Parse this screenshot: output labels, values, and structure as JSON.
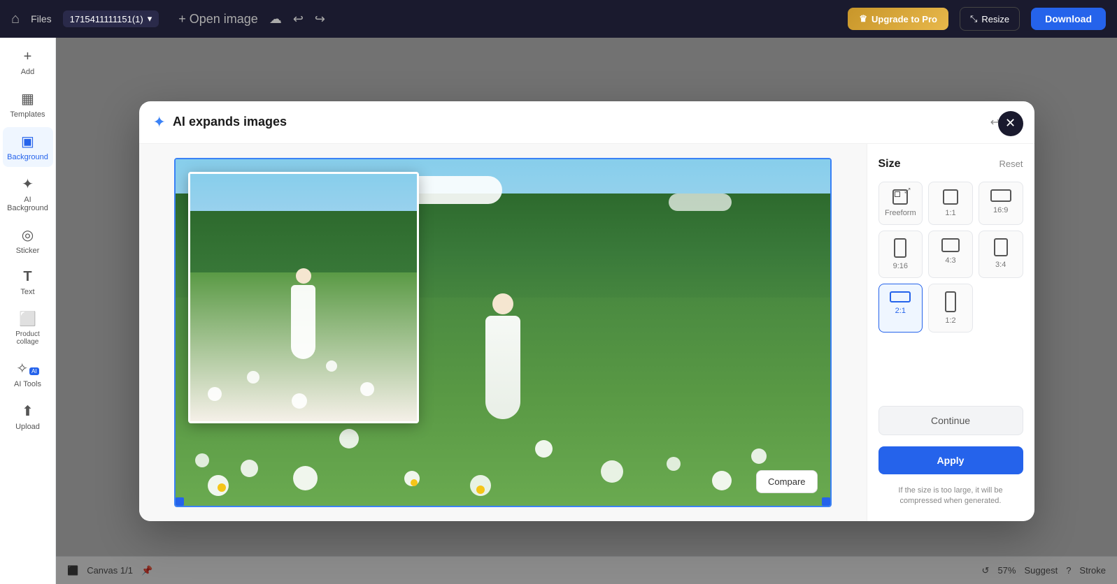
{
  "topbar": {
    "home_icon": "⌂",
    "files_label": "Files",
    "filename": "1715411111151(1)",
    "open_image_label": "+ Open image",
    "cloud_icon": "☁",
    "undo_icon": "↩",
    "redo_icon": "↪",
    "upgrade_label": "Upgrade to Pro",
    "resize_label": "Resize",
    "download_label": "Download"
  },
  "sidebar": {
    "items": [
      {
        "id": "add",
        "icon": "+",
        "label": "Add"
      },
      {
        "id": "templates",
        "icon": "▦",
        "label": "Templates"
      },
      {
        "id": "background",
        "icon": "▣",
        "label": "Background",
        "active": true
      },
      {
        "id": "ai-background",
        "icon": "✦",
        "label": "AI Background"
      },
      {
        "id": "sticker",
        "icon": "◎",
        "label": "Sticker"
      },
      {
        "id": "text",
        "icon": "T",
        "label": "Text"
      },
      {
        "id": "product-collage",
        "icon": "⬜",
        "label": "Product collage"
      },
      {
        "id": "ai-tools",
        "icon": "✧",
        "label": "AI Tools",
        "badge": "AI"
      },
      {
        "id": "upload",
        "icon": "⬆",
        "label": "Upload"
      }
    ]
  },
  "modal": {
    "title": "AI expands images",
    "undo_icon": "↩",
    "redo_icon": "↪",
    "close_icon": "✕",
    "compare_label": "Compare",
    "panel": {
      "title": "Size",
      "reset_label": "Reset",
      "size_options": [
        {
          "id": "freeform",
          "label": "Freeform",
          "selected": false
        },
        {
          "id": "1:1",
          "label": "1:1",
          "selected": false
        },
        {
          "id": "16:9",
          "label": "16:9",
          "selected": false
        },
        {
          "id": "9:16",
          "label": "9:16",
          "selected": false
        },
        {
          "id": "4:3",
          "label": "4:3",
          "selected": false
        },
        {
          "id": "3:4",
          "label": "3:4",
          "selected": false
        },
        {
          "id": "2:1",
          "label": "2:1",
          "selected": true
        },
        {
          "id": "1:2",
          "label": "1:2",
          "selected": false
        }
      ],
      "continue_label": "Continue",
      "apply_label": "Apply",
      "note": "If the size is too large, it will be compressed when generated."
    }
  },
  "bottom_bar": {
    "canvas_label": "Canvas 1/1",
    "refresh_icon": "↺",
    "zoom_label": "57%",
    "suggest_label": "Suggest",
    "help_icon": "?",
    "stroke_label": "Stroke"
  }
}
